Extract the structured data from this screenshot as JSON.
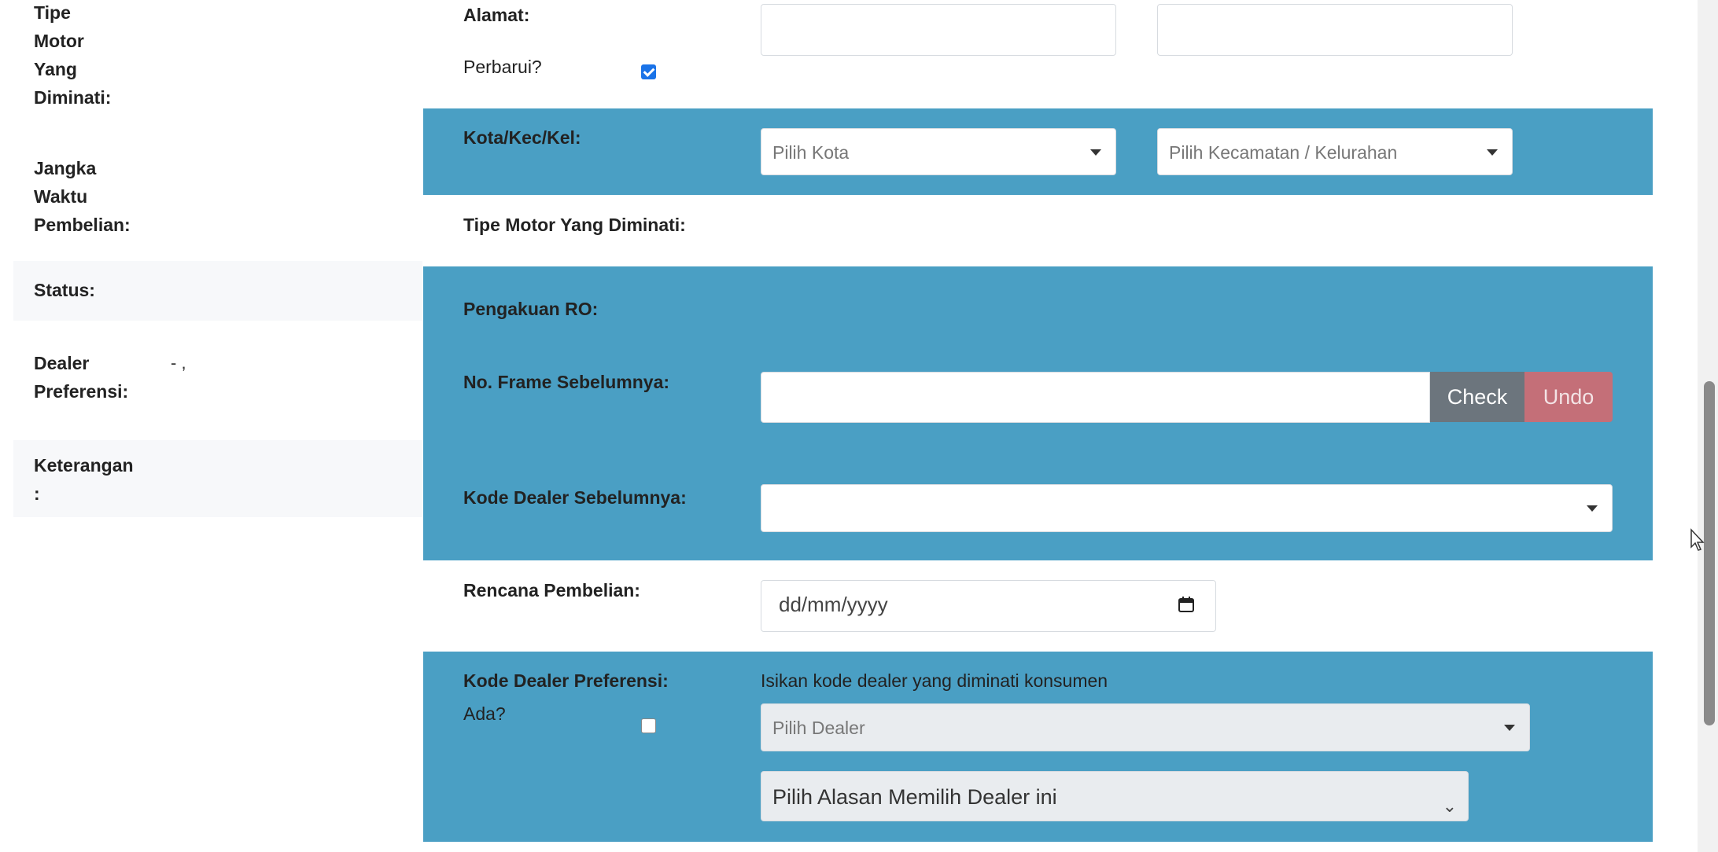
{
  "left_panel": {
    "rows": [
      {
        "label_lines": [
          "Tipe",
          "Motor",
          "Yang",
          "Diminati:"
        ],
        "value": ""
      },
      {
        "label_lines": [
          "Jangka",
          "Waktu",
          "Pembelian:"
        ],
        "value": ""
      },
      {
        "label_lines": [
          "Status:"
        ],
        "value": ""
      },
      {
        "label_lines": [
          "Dealer",
          "Preferensi:"
        ],
        "value": "- ,"
      },
      {
        "label_lines": [
          "Keterangan",
          ":"
        ],
        "value": ""
      }
    ]
  },
  "form": {
    "alamat": {
      "label": "Alamat:",
      "input1_value": "",
      "input2_value": ""
    },
    "perbarui": {
      "label": "Perbarui?",
      "checked": true
    },
    "kota": {
      "label": "Kota/Kec/Kel:",
      "kota_placeholder": "Pilih Kota",
      "kecamatan_placeholder": "Pilih Kecamatan / Kelurahan"
    },
    "tipe_motor": {
      "label": "Tipe Motor Yang Diminati:"
    },
    "pengakuan_ro": {
      "label": "Pengakuan RO:"
    },
    "no_frame": {
      "label": "No. Frame Sebelumnya:",
      "value": "",
      "check_label": "Check",
      "undo_label": "Undo"
    },
    "kode_dealer_sebelumnya": {
      "label": "Kode Dealer Sebelumnya:",
      "value": ""
    },
    "rencana_pembelian": {
      "label": "Rencana Pembelian:",
      "placeholder": "dd/mm/yyyy"
    },
    "kode_dealer_preferensi": {
      "label": "Kode Dealer Preferensi:",
      "hint": "Isikan kode dealer yang diminati konsumen",
      "ada_label": "Ada?",
      "ada_checked": false,
      "dealer_placeholder": "Pilih Dealer",
      "alasan_placeholder": "Pilih Alasan Memilih Dealer ini"
    }
  },
  "colors": {
    "section_blue": "#4a9fc4",
    "check_button": "#6c757d",
    "undo_button": "#c46f78",
    "checkbox_accent": "#1a73e8"
  },
  "icons": [
    "caret-down-icon",
    "chevron-down-icon",
    "calendar-icon",
    "checkmark-icon",
    "mouse-cursor-icon"
  ]
}
